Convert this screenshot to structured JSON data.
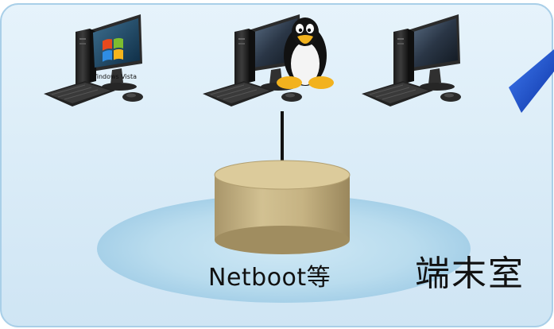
{
  "server_label": "Netboot等",
  "room_label": "端末室",
  "terminals": [
    {
      "os": "windows",
      "screen_text": "Windows Vista",
      "logo_icon": "windows-logo-icon"
    },
    {
      "os": "linux",
      "logo_icon": "linux-tux-icon"
    },
    {
      "os": "none"
    }
  ],
  "colors": {
    "panel_fill": "#d9ecf8",
    "panel_border": "#9ec8e6",
    "ellipse_fill": "#b9dcee",
    "cylinder_fill": "#c9b685",
    "cylinder_top": "#dccb9b",
    "pointer_arrow": "#1547c8"
  }
}
